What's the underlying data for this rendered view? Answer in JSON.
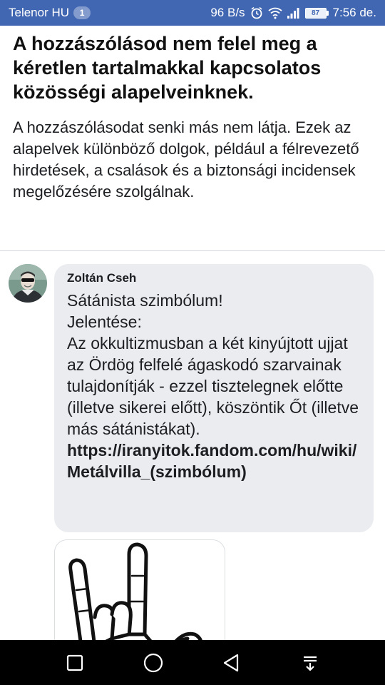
{
  "status_bar": {
    "carrier": "Telenor HU",
    "notification_count": "1",
    "network_speed": "96 B/s",
    "battery": "87",
    "time": "7:56 de."
  },
  "notice": {
    "title": "A hozzászólásod nem felel meg a kéretlen tartalmakkal kapcsolatos közösségi alapelveinknek.",
    "body": "A hozzászólásodat senki más nem látja. Ezek az alapelvek különböző dolgok, például a félrevezető hirdetések, a csalások és a biztonsági incidensek megelőzésére szolgálnak."
  },
  "comment": {
    "author": "Zoltán Cseh",
    "text": "Sátánista szimbólum!\nJelentése:\nAz okkultizmusban a két kinyújtott ujjat az Ördög felfelé ágaskodó szarvainak tulajdonítják - ezzel tisztelegnek előtte (illetve sikerei előtt), köszöntik Őt (illetve más sátánistákat).",
    "link": "https://iranyitok.fandom.com/hu/wiki/Metálvilla_(szimbólum)"
  },
  "icons": {
    "status": [
      "alarm-icon",
      "wifi-icon",
      "signal-icon",
      "battery-icon"
    ],
    "nav": [
      "recent-apps-icon",
      "home-icon",
      "back-icon",
      "notification-pulldown-icon"
    ],
    "attachment": "horns-hand-icon"
  },
  "colors": {
    "status_bar": "#4267b2",
    "bubble": "#eaecef",
    "nav_bar": "#000000"
  }
}
